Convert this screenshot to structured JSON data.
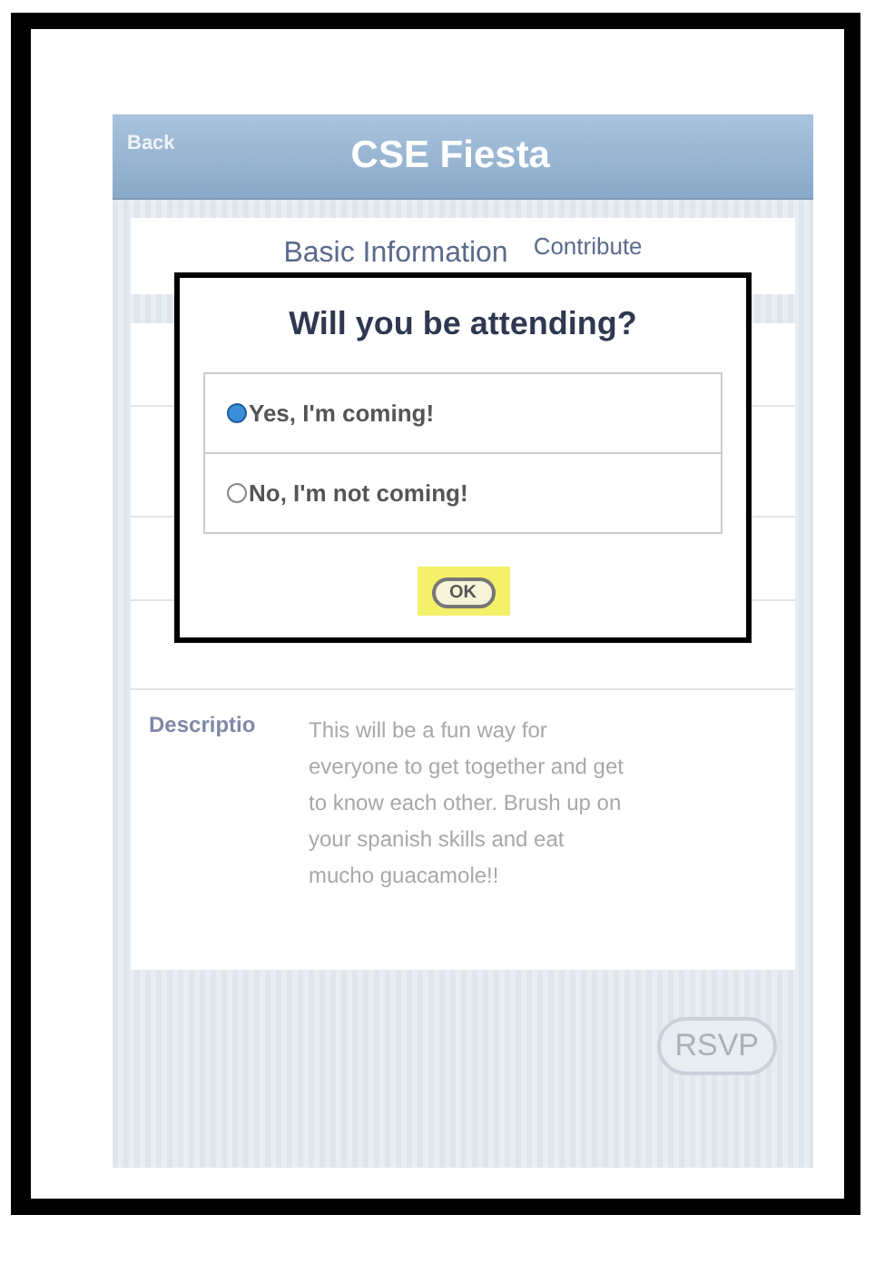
{
  "nav_bar": {
    "back_button": "Back",
    "title": "CSE Fiesta"
  },
  "tabs": [
    {
      "label": "Basic Information",
      "selected": true
    },
    {
      "label": "Contribute",
      "selected": false
    }
  ],
  "details": {
    "description_label": "Descriptio",
    "description": "This will be a fun way for everyone to get together and get to know each other. Brush up on your spanish skills and eat mucho guacamole!!"
  },
  "rsvp_button": "RSVP",
  "dialog": {
    "title": "Will you be attending?",
    "options": [
      {
        "label": "Yes, I'm coming!",
        "selected": true
      },
      {
        "label": "No, I'm not coming!",
        "selected": false
      }
    ],
    "ok_button": {
      "label": "OK",
      "highlighted": true
    }
  }
}
